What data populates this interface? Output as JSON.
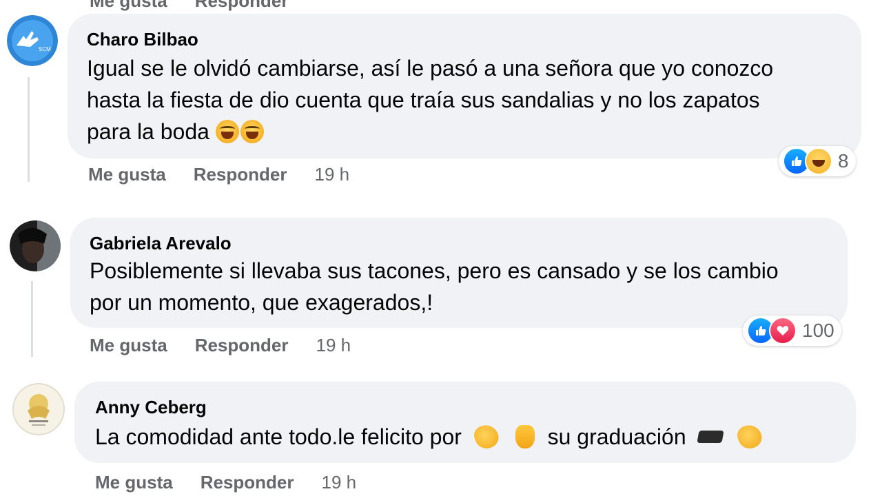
{
  "top_partial": [
    "Me gusta",
    "Responder"
  ],
  "comments": [
    {
      "author": "Charo Bilbao",
      "lines": [
        "Igual se le olvidó cambiarse, así le pasó a una señora que yo conozco",
        "hasta la fiesta de dio cuenta que traía sus sandalias y no los zapatos",
        "para la boda"
      ],
      "reactions": {
        "icons": [
          "like-icon",
          "haha-icon"
        ],
        "count": "8"
      },
      "like_label": "Me gusta",
      "reply_label": "Responder",
      "time": "19 h"
    },
    {
      "author": "Gabriela Arevalo",
      "lines": [
        "Posiblemente si llevaba sus tacones, pero es cansado y se los cambio",
        "por un momento, que exagerados,!"
      ],
      "reactions": {
        "icons": [
          "like-icon",
          "love-icon"
        ],
        "count": "100"
      },
      "like_label": "Me gusta",
      "reply_label": "Responder",
      "time": "19 h"
    },
    {
      "author": "Anny Ceberg",
      "text_parts": [
        "La comodidad ante todo.le felicito por",
        "su graduación"
      ],
      "like_label": "Me gusta",
      "reply_label": "Responder",
      "time": "19 h"
    }
  ],
  "colors": {
    "bubble": "#f0f2f5",
    "meta": "#65676b",
    "like_blue": "#0866ff",
    "love_red": "#e61e4d"
  }
}
